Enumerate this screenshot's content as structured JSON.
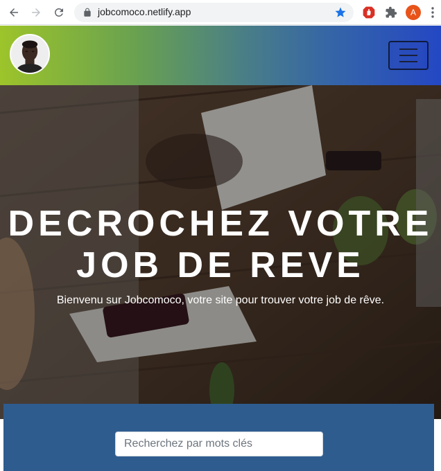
{
  "browser": {
    "url": "jobcomoco.netlify.app",
    "profile_initial": "A"
  },
  "navbar": {
    "avatar_alt": "profile photo"
  },
  "hero": {
    "title_line1": "DECROCHEZ VOTRE",
    "title_line2": "JOB DE REVE",
    "subtitle": "Bienvenu sur Jobcomoco, votre site pour trouver votre job de rêve."
  },
  "search": {
    "placeholder": "Recherchez par mots clés"
  },
  "colors": {
    "nav_gradient_start": "#9dc42a",
    "nav_gradient_end": "#2447c4",
    "search_section_bg": "#2e5c8f",
    "chrome_avatar": "#e8531a",
    "star": "#1a73e8"
  },
  "icons": [
    "back-arrow-icon",
    "forward-arrow-icon",
    "reload-icon",
    "lock-icon",
    "star-icon",
    "adblock-icon",
    "puzzle-icon",
    "more-vert-icon",
    "hamburger-icon"
  ]
}
